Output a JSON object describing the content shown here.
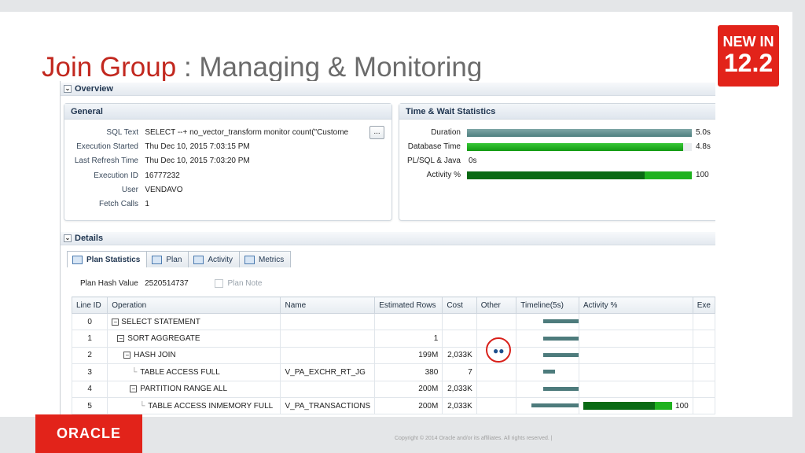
{
  "slide": {
    "title_accent": "Join Group",
    "title_rest": " : Managing & Monitoring",
    "badge_line1": "NEW IN",
    "badge_line2": "12.2",
    "logo": "ORACLE",
    "copyright": "Copyright © 2014 Oracle and/or its affiliates. All rights reserved.  |"
  },
  "monitor": {
    "overview_label": "Overview",
    "details_label": "Details",
    "general": {
      "title": "General",
      "rows": [
        {
          "key": "SQL Text",
          "value": "SELECT --+ no_vector_transform monitor count(\"Custome"
        },
        {
          "key": "Execution Started",
          "value": "Thu Dec 10, 2015 7:03:15 PM"
        },
        {
          "key": "Last Refresh Time",
          "value": "Thu Dec 10, 2015 7:03:20 PM"
        },
        {
          "key": "Execution ID",
          "value": "16777232"
        },
        {
          "key": "User",
          "value": "VENDAVO"
        },
        {
          "key": "Fetch Calls",
          "value": "1"
        }
      ],
      "more_button": "..."
    },
    "time_wait": {
      "title": "Time & Wait Statistics",
      "rows": [
        {
          "key": "Duration",
          "value": "5.0s",
          "fill": 1.0,
          "color": "#4e7f7f"
        },
        {
          "key": "Database Time",
          "value": "4.8s",
          "fill": 0.96,
          "color": "#18a818"
        },
        {
          "key": "PL/SQL & Java",
          "value": "0s",
          "fill": 0,
          "color": "#18a818"
        },
        {
          "key": "Activity %",
          "value": "100",
          "fill": 1.0,
          "color": "#0a6a14"
        }
      ]
    },
    "tabs": [
      {
        "label": "Plan Statistics",
        "icon": "table-icon"
      },
      {
        "label": "Plan",
        "icon": "tree-icon"
      },
      {
        "label": "Activity",
        "icon": "chart-icon"
      },
      {
        "label": "Metrics",
        "icon": "metrics-icon"
      }
    ],
    "plan_hash_label": "Plan Hash Value",
    "plan_hash_value": "2520514737",
    "plan_note_label": "Plan Note",
    "columns": [
      "Line ID",
      "Operation",
      "Name",
      "Estimated Rows",
      "Cost",
      "Other",
      "Timeline(5s)",
      "Activity %",
      "Exe"
    ],
    "rows": [
      {
        "id": "0",
        "op": "SELECT STATEMENT",
        "name": "",
        "rows": "",
        "cost": "",
        "activity": ""
      },
      {
        "id": "1",
        "op": "SORT AGGREGATE",
        "name": "",
        "rows": "1",
        "cost": "",
        "activity": ""
      },
      {
        "id": "2",
        "op": "HASH JOIN",
        "name": "",
        "rows": "199M",
        "cost": "2,033K",
        "activity": ""
      },
      {
        "id": "3",
        "op": "TABLE ACCESS FULL",
        "name": "V_PA_EXCHR_RT_JG",
        "rows": "380",
        "cost": "7",
        "activity": ""
      },
      {
        "id": "4",
        "op": "PARTITION RANGE ALL",
        "name": "",
        "rows": "200M",
        "cost": "2,033K",
        "activity": ""
      },
      {
        "id": "5",
        "op": "TABLE ACCESS INMEMORY FULL",
        "name": "V_PA_TRANSACTIONS",
        "rows": "200M",
        "cost": "2,033K",
        "activity": "100"
      }
    ]
  }
}
